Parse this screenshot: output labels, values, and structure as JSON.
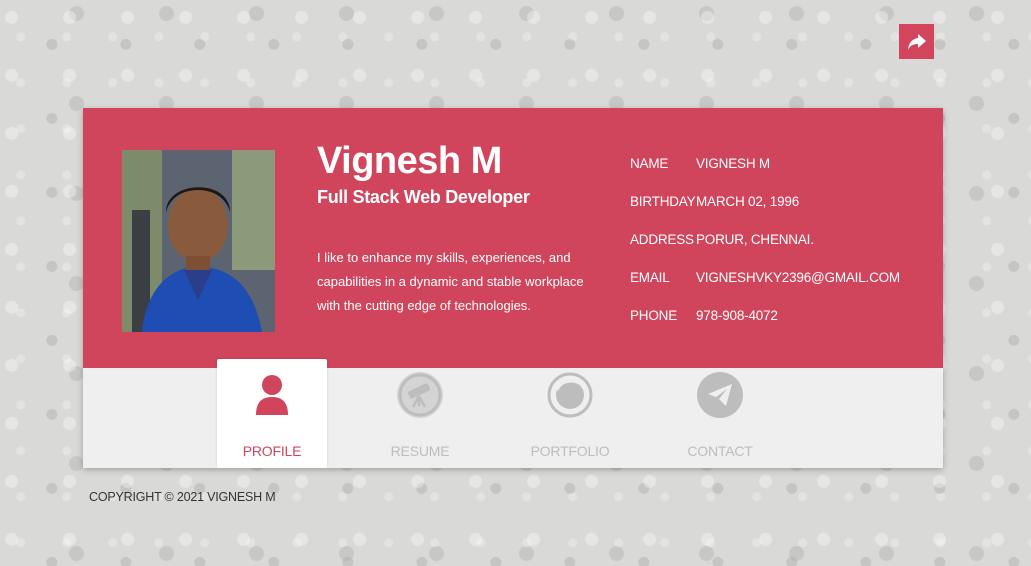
{
  "share": {
    "icon": "share-arrow-icon"
  },
  "profile": {
    "name": "Vignesh M",
    "title": "Full Stack Web Developer",
    "bio": "I like to enhance my skills, experiences, and capabilities in a dynamic and stable workplace with the cutting edge of technologies.",
    "photo_icon": "profile-photo"
  },
  "info": [
    {
      "label": "NAME",
      "value": "VIGNESH M"
    },
    {
      "label": "BIRTHDAY",
      "value": "MARCH 02, 1996"
    },
    {
      "label": "ADDRESS",
      "value": "PORUR, CHENNAI."
    },
    {
      "label": "EMAIL",
      "value": "VIGNESHVKY2396@GMAIL.COM"
    },
    {
      "label": "PHONE",
      "value": "978-908-4072"
    }
  ],
  "tabs": [
    {
      "label": "PROFILE",
      "icon": "user-icon",
      "active": true
    },
    {
      "label": "RESUME",
      "icon": "telescope-icon",
      "active": false
    },
    {
      "label": "PORTFOLIO",
      "icon": "portfolio-icon",
      "active": false
    },
    {
      "label": "CONTACT",
      "icon": "paper-plane-icon",
      "active": false
    }
  ],
  "footer": {
    "copyright": "COPYRIGHT © 2021 VIGNESH M"
  },
  "colors": {
    "accent": "#d1455c",
    "tab_inactive": "#bdbdbd",
    "panel_bottom": "#efefef",
    "background": "#d9d9d7"
  }
}
